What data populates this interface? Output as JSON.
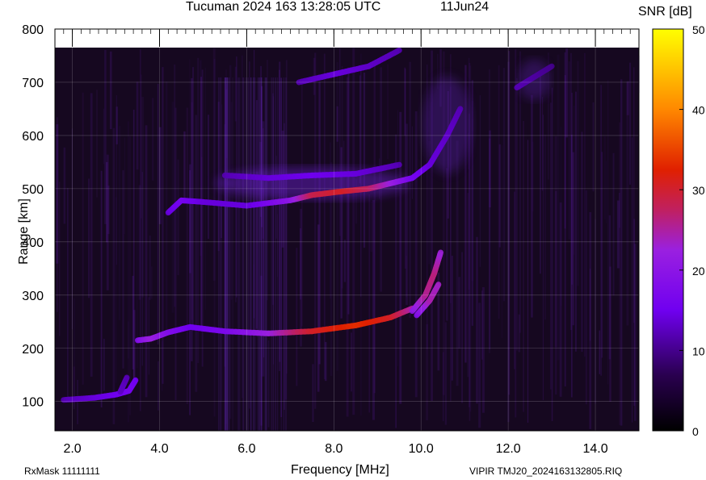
{
  "header": {
    "title": "Tucuman 2024 163 13:28:05 UTC",
    "date": "11Jun24",
    "colorbar_label": "SNR [dB]"
  },
  "footer": {
    "left": "RxMask 11111111",
    "right": "VIPIR  TMJ20_2024163132805.RIQ"
  },
  "chart_data": {
    "type": "heatmap",
    "title": "Tucuman 2024 163 13:28:05 UTC",
    "xlabel": "Frequency [MHz]",
    "ylabel": "Range [km]",
    "xlim": [
      1.6,
      15.0
    ],
    "ylim": [
      45,
      800
    ],
    "x_ticks": [
      "2.0",
      "4.0",
      "6.0",
      "8.0",
      "10.0",
      "12.0",
      "14.0"
    ],
    "x_tick_values": [
      2,
      4,
      6,
      8,
      10,
      12,
      14
    ],
    "y_ticks": [
      "100",
      "200",
      "300",
      "400",
      "500",
      "600",
      "700",
      "800"
    ],
    "y_tick_values": [
      100,
      200,
      300,
      400,
      500,
      600,
      700,
      800
    ],
    "grid": true,
    "colorbar": {
      "label": "SNR [dB]",
      "range": [
        0,
        50
      ],
      "ticks": [
        "0",
        "10",
        "20",
        "30",
        "40",
        "50"
      ],
      "tick_values": [
        0,
        10,
        20,
        30,
        40,
        50
      ],
      "colors": [
        "#000000",
        "#3a0060",
        "#7a00ff",
        "#b030c0",
        "#ff2000",
        "#ff8800",
        "#ffff00"
      ]
    },
    "traces": [
      {
        "name_hint": "E-trace",
        "points": [
          [
            1.8,
            103,
            12
          ],
          [
            2.5,
            107,
            14
          ],
          [
            3.0,
            113,
            15
          ],
          [
            3.3,
            120,
            16
          ],
          [
            3.45,
            140,
            15
          ]
        ]
      },
      {
        "name_hint": "E-trace-echo",
        "points": [
          [
            3.1,
            118,
            13
          ],
          [
            3.25,
            145,
            12
          ]
        ]
      },
      {
        "name_hint": "F1-lower",
        "points": [
          [
            3.5,
            215,
            18
          ],
          [
            3.8,
            218,
            22
          ],
          [
            4.2,
            230,
            18
          ],
          [
            4.7,
            240,
            15
          ],
          [
            5.5,
            232,
            17
          ],
          [
            6.5,
            228,
            22
          ],
          [
            7.5,
            232,
            30
          ],
          [
            8.5,
            243,
            33
          ],
          [
            9.3,
            258,
            30
          ],
          [
            9.8,
            275,
            24
          ]
        ]
      },
      {
        "name_hint": "F-cusp",
        "points": [
          [
            9.8,
            270,
            20
          ],
          [
            10.1,
            300,
            25
          ],
          [
            10.3,
            340,
            26
          ],
          [
            10.45,
            380,
            22
          ]
        ]
      },
      {
        "name_hint": "F-cusp-2",
        "points": [
          [
            9.9,
            262,
            18
          ],
          [
            10.2,
            290,
            24
          ],
          [
            10.4,
            320,
            23
          ]
        ]
      },
      {
        "name_hint": "F2-ordinary",
        "points": [
          [
            4.2,
            455,
            14
          ],
          [
            4.5,
            478,
            16
          ],
          [
            5.0,
            475,
            14
          ],
          [
            6.0,
            468,
            14
          ],
          [
            7.0,
            478,
            20
          ],
          [
            7.5,
            488,
            28
          ],
          [
            8.2,
            495,
            30
          ],
          [
            8.8,
            500,
            27
          ],
          [
            9.3,
            510,
            22
          ],
          [
            9.8,
            520,
            16
          ],
          [
            10.2,
            545,
            14
          ],
          [
            10.6,
            600,
            13
          ],
          [
            10.9,
            650,
            12
          ]
        ]
      },
      {
        "name_hint": "F2-second-hop",
        "points": [
          [
            5.5,
            525,
            12
          ],
          [
            6.5,
            520,
            14
          ],
          [
            7.5,
            525,
            15
          ],
          [
            8.5,
            528,
            14
          ],
          [
            9.5,
            545,
            12
          ]
        ]
      },
      {
        "name_hint": "upper-echo",
        "points": [
          [
            7.2,
            700,
            12
          ],
          [
            8.0,
            715,
            14
          ],
          [
            8.8,
            730,
            13
          ],
          [
            9.5,
            760,
            12
          ]
        ]
      },
      {
        "name_hint": "upper-echo-2",
        "points": [
          [
            12.2,
            690,
            12
          ],
          [
            12.6,
            710,
            11
          ],
          [
            13.0,
            730,
            10
          ]
        ]
      }
    ]
  }
}
